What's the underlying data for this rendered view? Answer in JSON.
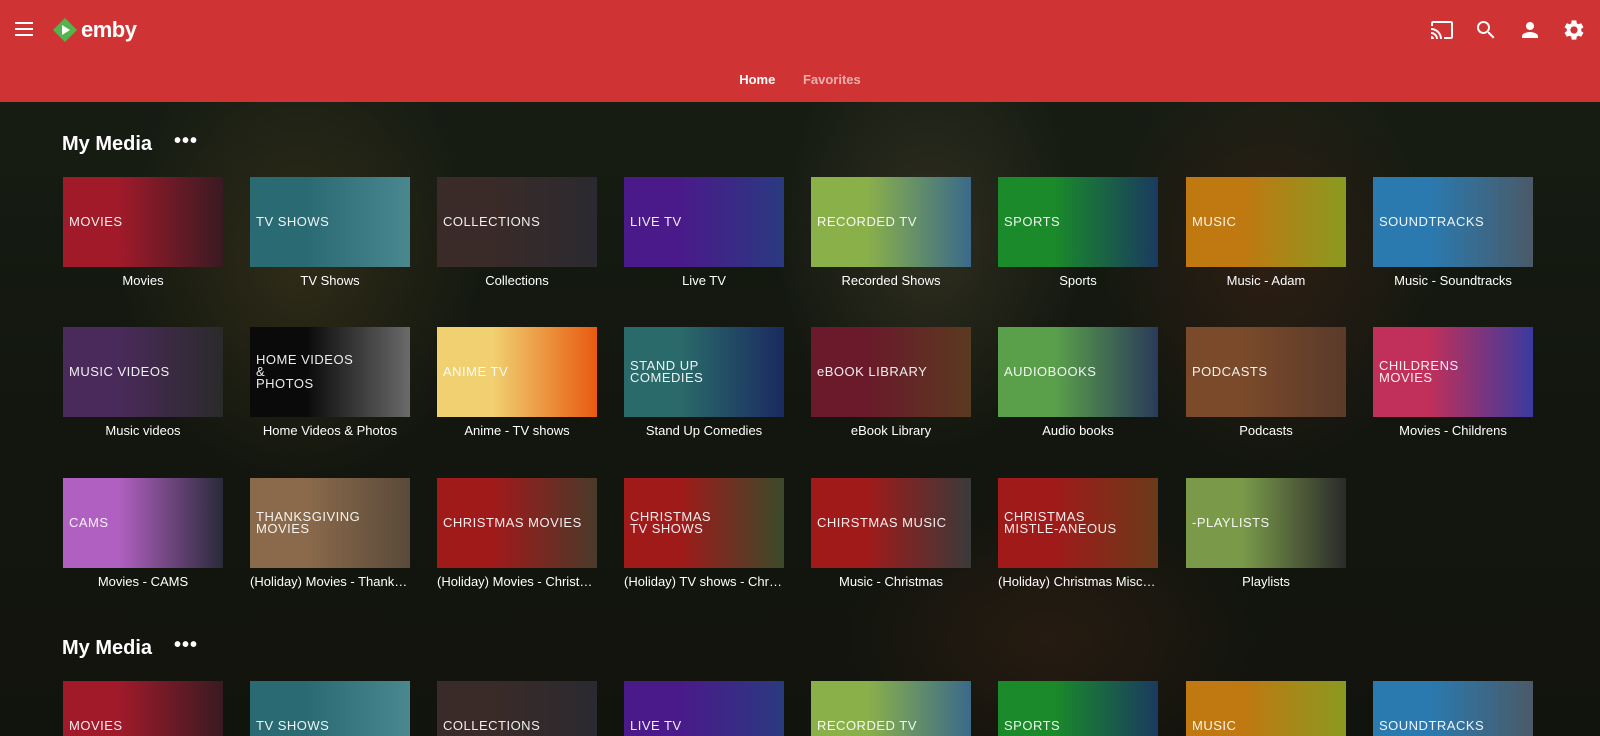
{
  "app": {
    "logo_text": "emby"
  },
  "header": {
    "tabs": [
      {
        "label": "Home"
      },
      {
        "label": "Favorites"
      }
    ],
    "icons": [
      "cast-icon",
      "search-icon",
      "user-icon",
      "settings-icon"
    ]
  },
  "sections": [
    {
      "title": "My Media",
      "more": "•••"
    },
    {
      "title": "My Media",
      "more": "•••"
    }
  ],
  "libraries": [
    {
      "thumb": "MOVIES",
      "caption": "Movies",
      "c1": "#a01a2a",
      "c2": "#3a1a22"
    },
    {
      "thumb": "TV SHOWS",
      "caption": "TV Shows",
      "c1": "#2a6a72",
      "c2": "#4a8890"
    },
    {
      "thumb": "COLLECTIONS",
      "caption": "Collections",
      "c1": "#3a2a28",
      "c2": "#2a2a30"
    },
    {
      "thumb": "LIVE  TV",
      "caption": "Live TV",
      "c1": "#4a1a8a",
      "c2": "#2a3a80"
    },
    {
      "thumb": "RECORDED  TV",
      "caption": "Recorded Shows",
      "c1": "#8ab04a",
      "c2": "#3a6a8a"
    },
    {
      "thumb": "SPORTS",
      "caption": "Sports",
      "c1": "#1a8a2a",
      "c2": "#1a3a60"
    },
    {
      "thumb": "MUSIC",
      "caption": "Music - Adam",
      "c1": "#c07810",
      "c2": "#8a9a20"
    },
    {
      "thumb": "SOUNDTRACKS",
      "caption": "Music - Soundtracks",
      "c1": "#2a7ab0",
      "c2": "#4a5a68"
    },
    {
      "thumb": "MUSIC VIDEOS",
      "caption": "Music videos",
      "c1": "#4a2a5a",
      "c2": "#2a2a2a"
    },
    {
      "thumb": "HOME VIDEOS\n&\nPHOTOS",
      "caption": "Home Videos & Photos",
      "c1": "#0a0a0a",
      "c2": "#6a6a6a"
    },
    {
      "thumb": "ANIME  TV",
      "caption": "Anime - TV shows",
      "c1": "#f0d070",
      "c2": "#e85a10"
    },
    {
      "thumb": "STAND UP\nCOMEDIES",
      "caption": "Stand Up Comedies",
      "c1": "#2a6a6a",
      "c2": "#1a2a60"
    },
    {
      "thumb": "eBOOK LIBRARY",
      "caption": "eBook Library",
      "c1": "#6a1a2a",
      "c2": "#5a3a20"
    },
    {
      "thumb": "AUDIOBOOKS",
      "caption": "Audio books",
      "c1": "#5aa04a",
      "c2": "#2a3a5a"
    },
    {
      "thumb": "PODCASTS",
      "caption": "Podcasts",
      "c1": "#7a4a2a",
      "c2": "#5a3a2a"
    },
    {
      "thumb": "CHILDRENS\nMOVIES",
      "caption": "Movies - Childrens",
      "c1": "#c0305a",
      "c2": "#3a3aa0"
    },
    {
      "thumb": "CAMS",
      "caption": "Movies - CAMS",
      "c1": "#b060c0",
      "c2": "#2a2a3a"
    },
    {
      "thumb": "THANKSGIVING\nMOVIES",
      "caption": "(Holiday) Movies - Thanksgiving",
      "c1": "#8a6a4a",
      "c2": "#5a4a3a"
    },
    {
      "thumb": "CHRISTMAS MOVIES",
      "caption": "(Holiday) Movies - Christmas",
      "c1": "#a01a1a",
      "c2": "#4a3a2a"
    },
    {
      "thumb": "CHRISTMAS\nTV SHOWS",
      "caption": "(Holiday) TV shows - Christmas",
      "c1": "#a01a1a",
      "c2": "#3a4a2a"
    },
    {
      "thumb": "CHIRSTMAS MUSIC",
      "caption": "Music - Christmas",
      "c1": "#a01a1a",
      "c2": "#3a3a3a"
    },
    {
      "thumb": "CHRISTMAS\nMISTLE-ANEOUS",
      "caption": "(Holiday) Christmas Miscellaneous",
      "c1": "#a01a1a",
      "c2": "#6a3a1a"
    },
    {
      "thumb": "-PLAYLISTS",
      "caption": "Playlists",
      "c1": "#7a9a4a",
      "c2": "#2a2a2a"
    }
  ],
  "row2_libraries": [
    {
      "thumb": "MOVIES",
      "c1": "#a01a2a",
      "c2": "#3a1a22"
    },
    {
      "thumb": "TV SHOWS",
      "c1": "#2a6a72",
      "c2": "#4a8890"
    },
    {
      "thumb": "COLLECTIONS",
      "c1": "#3a2a28",
      "c2": "#2a2a30"
    },
    {
      "thumb": "LIVE  TV",
      "c1": "#4a1a8a",
      "c2": "#2a3a80"
    },
    {
      "thumb": "RECORDED  TV",
      "c1": "#8ab04a",
      "c2": "#3a6a8a"
    },
    {
      "thumb": "SPORTS",
      "c1": "#1a8a2a",
      "c2": "#1a3a60"
    },
    {
      "thumb": "MUSIC",
      "c1": "#c07810",
      "c2": "#8a9a20"
    },
    {
      "thumb": "SOUNDTRACKS",
      "c1": "#2a7ab0",
      "c2": "#4a5a68"
    }
  ]
}
